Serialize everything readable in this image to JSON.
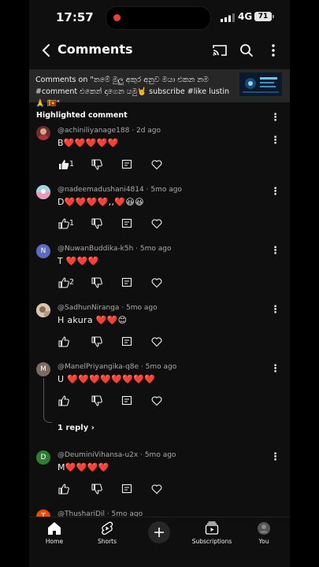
{
  "status": {
    "time": "17:57",
    "network": "4G",
    "battery": "71"
  },
  "header": {
    "title": "Comments"
  },
  "context": {
    "text": "Comments on \"තමේ මුලු අකුර අනුව මයා එකන නම #comment එකෙන් දාගෙන යමු🤘 subscribe #like lustin 🙏 🇱🇰\""
  },
  "section": {
    "highlighted": "Highlighted comment"
  },
  "comments": [
    {
      "author": "@achiniliyanage188",
      "time": "2d ago",
      "text": "B❤️❤️❤️❤️❤️",
      "likes": "1",
      "avatar_color": "#6b2e2e",
      "avatar_letter": ""
    },
    {
      "author": "@nadeemadushani4814",
      "time": "5mo ago",
      "text": "D❤️❤️❤️❤️,,❤️😃😃",
      "likes": "1",
      "avatar_color": "#7ab9d6",
      "avatar_letter": ""
    },
    {
      "author": "@NuwanBuddika-k5h",
      "time": "5mo ago",
      "text": "T ❤️❤️❤️",
      "likes": "2",
      "avatar_color": "#5c6bc0",
      "avatar_letter": "N"
    },
    {
      "author": "@SadhunNiranga",
      "time": "5mo ago",
      "text": "H  akura ❤️❤️😊",
      "likes": "",
      "avatar_color": "#c9b59a",
      "avatar_letter": ""
    },
    {
      "author": "@ManelPriyangika-q8e",
      "time": "5mo ago",
      "text": "U ❤️❤️❤️❤️❤️❤️❤️❤️",
      "likes": "",
      "avatar_color": "#7b6b63",
      "avatar_letter": "M"
    },
    {
      "author": "@DeuminiVihansa-u2x",
      "time": "5mo ago",
      "text": "M❤️❤️❤️❤️",
      "likes": "",
      "avatar_color": "#2e7d32",
      "avatar_letter": "D"
    },
    {
      "author": "@ThushariDil",
      "time": "5mo ago",
      "text": "",
      "likes": "",
      "avatar_color": "#e65100",
      "avatar_letter": "T"
    }
  ],
  "replies": {
    "label": "1 reply"
  },
  "nav": {
    "items": [
      {
        "label": "Home",
        "icon": "home-icon"
      },
      {
        "label": "Shorts",
        "icon": "shorts-icon"
      },
      {
        "label": "",
        "icon": "create-icon"
      },
      {
        "label": "Subscriptions",
        "icon": "subscriptions-icon"
      },
      {
        "label": "You",
        "icon": "avatar-icon"
      }
    ]
  },
  "colors": {
    "background": "#0f0f0f",
    "context_bg": "#272727",
    "heart": "#e53935"
  }
}
